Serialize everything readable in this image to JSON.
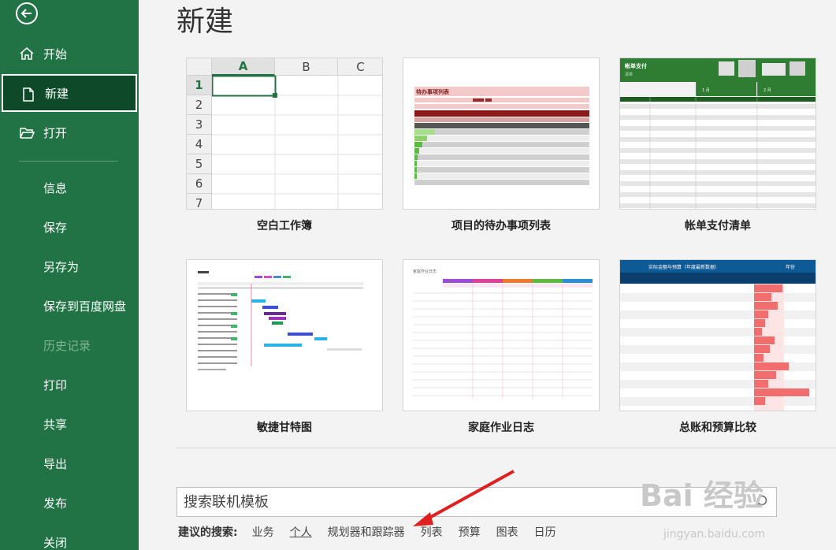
{
  "sidebar": {
    "items": [
      {
        "label": "开始",
        "icon": "home-icon"
      },
      {
        "label": "新建",
        "icon": "new-file-icon"
      },
      {
        "label": "打开",
        "icon": "folder-open-icon"
      },
      {
        "label": "信息"
      },
      {
        "label": "保存"
      },
      {
        "label": "另存为"
      },
      {
        "label": "保存到百度网盘"
      },
      {
        "label": "历史记录"
      },
      {
        "label": "打印"
      },
      {
        "label": "共享"
      },
      {
        "label": "导出"
      },
      {
        "label": "发布"
      },
      {
        "label": "关闭"
      }
    ]
  },
  "main": {
    "title": "新建",
    "templates": [
      {
        "label": "空白工作簿"
      },
      {
        "label": "项目的待办事项列表",
        "thumb_title": "待办事项列表"
      },
      {
        "label": "帐单支付清单",
        "thumb_title": "帐单支付",
        "thumb_sub": "清单",
        "thumb_month1": "1 月",
        "thumb_month2": "2 月"
      },
      {
        "label": "敏捷甘特图"
      },
      {
        "label": "家庭作业日志",
        "thumb_title": "家庭作业日志"
      },
      {
        "label": "总账和预算比较",
        "thumb_title": "实际金额与预算（年度最新数据）",
        "thumb_right": "年份"
      }
    ],
    "blank": {
      "col_headers": [
        "A",
        "B",
        "C"
      ],
      "row_headers": [
        "1",
        "2",
        "3",
        "4",
        "5",
        "6",
        "7"
      ]
    },
    "search": {
      "placeholder": "搜索联机模板"
    },
    "suggestions": {
      "label": "建议的搜索:",
      "items": [
        "业务",
        "个人",
        "规划器和跟踪器",
        "列表",
        "预算",
        "图表",
        "日历"
      ],
      "active": "个人"
    }
  },
  "watermark": {
    "text": "Bai 经验",
    "sub": "jingyan.baidu.com"
  },
  "colors": {
    "sidebar": "#217346",
    "active": "#0e4a2a",
    "accent": "#217346"
  }
}
